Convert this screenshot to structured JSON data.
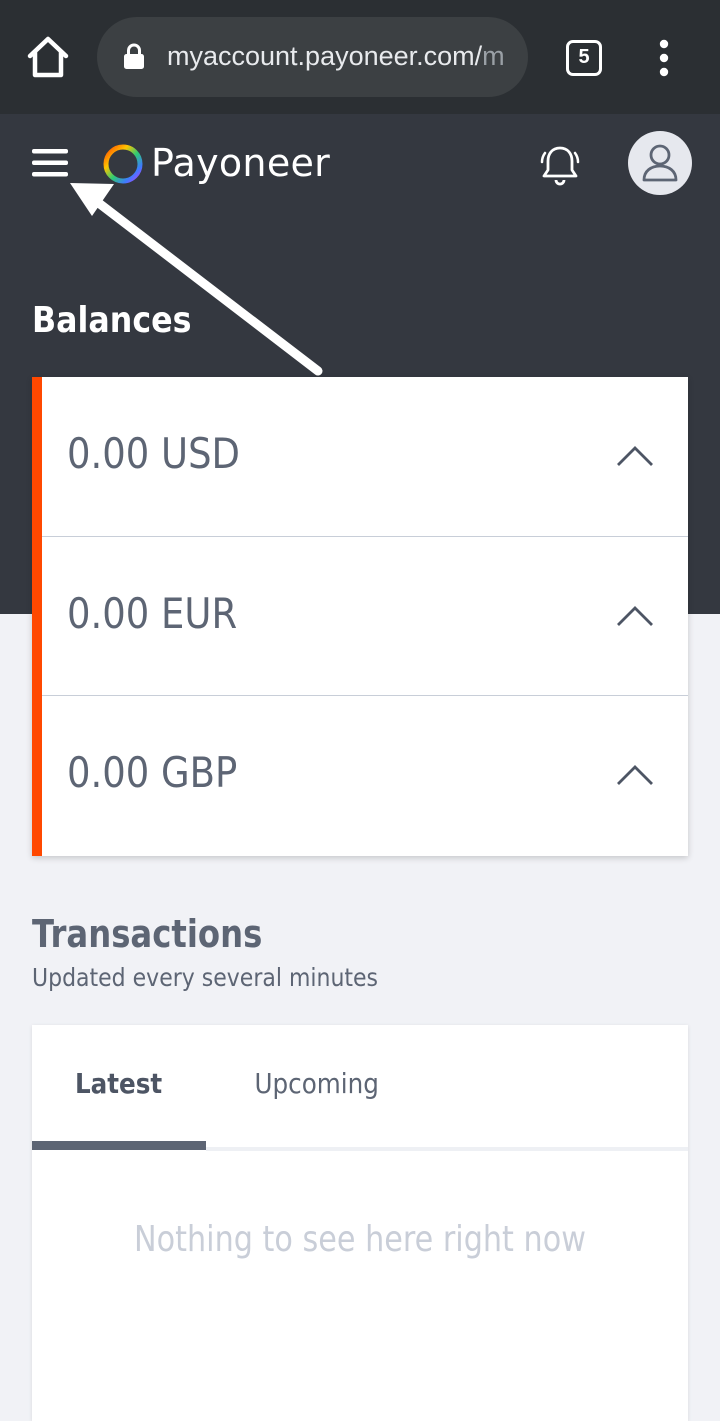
{
  "browser": {
    "url_main": "myaccount.payoneer.com/",
    "url_rest": "m",
    "tab_count": "5"
  },
  "header": {
    "brand": "Payoneer"
  },
  "balances": {
    "title": "Balances",
    "items": [
      {
        "amount": "0.00 USD"
      },
      {
        "amount": "0.00 EUR"
      },
      {
        "amount": "0.00 GBP"
      }
    ],
    "accent_color": "#ff4800"
  },
  "transactions": {
    "title": "Transactions",
    "subtitle": "Updated every several minutes",
    "tabs": [
      {
        "label": "Latest",
        "active": true
      },
      {
        "label": "Upcoming",
        "active": false
      }
    ],
    "empty_message": "Nothing to see here right now"
  },
  "colors": {
    "header_bg": "#343840",
    "browser_bg": "#2b2f33",
    "page_bg": "#f1f2f6",
    "text_muted": "#5d6574"
  }
}
